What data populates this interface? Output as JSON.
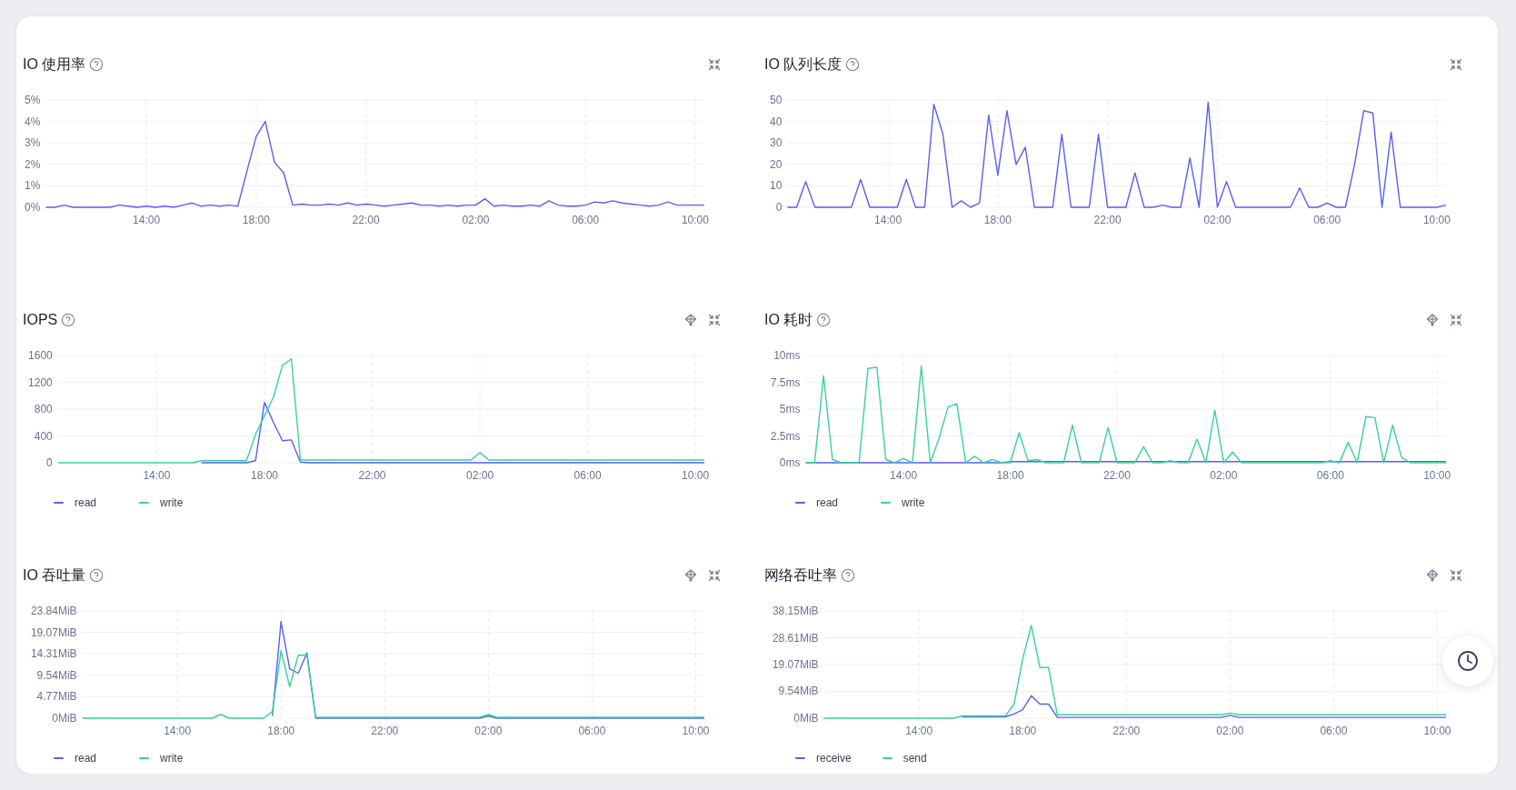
{
  "panels": [
    {
      "title": "IO 使用率",
      "chart_data": {
        "type": "line",
        "grid": true,
        "ylim": [
          0,
          5
        ],
        "categories": [
          null,
          null,
          null,
          null,
          null,
          null,
          null,
          null,
          null,
          null,
          null,
          "14:00",
          null,
          null,
          null,
          null,
          null,
          null,
          null,
          null,
          null,
          null,
          null,
          "18:00",
          null,
          null,
          null,
          null,
          null,
          null,
          null,
          null,
          null,
          null,
          null,
          "22:00",
          null,
          null,
          null,
          null,
          null,
          null,
          null,
          null,
          null,
          null,
          null,
          "02:00",
          null,
          null,
          null,
          null,
          null,
          null,
          null,
          null,
          null,
          null,
          null,
          "06:00",
          null,
          null,
          null,
          null,
          null,
          null,
          null,
          null,
          null,
          null,
          null,
          "10:00",
          null
        ],
        "yticks": [
          {
            "value": 0,
            "label": "0%"
          },
          {
            "value": 1,
            "label": "1%"
          },
          {
            "value": 2,
            "label": "2%"
          },
          {
            "value": 3,
            "label": "3%"
          },
          {
            "value": 4,
            "label": "4%"
          },
          {
            "value": 5,
            "label": "5%"
          }
        ],
        "values": [
          0,
          0,
          0.1,
          0,
          0,
          0,
          0,
          0,
          0.1,
          0.05,
          0,
          0.05,
          0,
          0.05,
          0,
          0.1,
          0.2,
          0.05,
          0.1,
          0.05,
          0.1,
          0.05,
          1.7,
          3.3,
          4.0,
          2.1,
          1.6,
          0.1,
          0.15,
          0.1,
          0.1,
          0.15,
          0.1,
          0.2,
          0.1,
          0.15,
          0.1,
          0.05,
          0.1,
          0.15,
          0.2,
          0.1,
          0.1,
          0.05,
          0.1,
          0.05,
          0.1,
          0.1,
          0.4,
          0.05,
          0.1,
          0.05,
          0.05,
          0.1,
          0.05,
          0.3,
          0.1,
          0.05,
          0.05,
          0.1,
          0.25,
          0.2,
          0.3,
          0.2,
          0.15,
          0.1,
          0.05,
          0.1,
          0.25,
          0.1,
          0.1,
          0.1,
          0.1
        ]
      }
    },
    {
      "title": "IO 队列长度",
      "chart_data": {
        "type": "line",
        "grid": true,
        "ylim": [
          0,
          50
        ],
        "categories": [
          null,
          null,
          null,
          null,
          null,
          null,
          null,
          null,
          null,
          null,
          null,
          "14:00",
          null,
          null,
          null,
          null,
          null,
          null,
          null,
          null,
          null,
          null,
          null,
          "18:00",
          null,
          null,
          null,
          null,
          null,
          null,
          null,
          null,
          null,
          null,
          null,
          "22:00",
          null,
          null,
          null,
          null,
          null,
          null,
          null,
          null,
          null,
          null,
          null,
          "02:00",
          null,
          null,
          null,
          null,
          null,
          null,
          null,
          null,
          null,
          null,
          null,
          "06:00",
          null,
          null,
          null,
          null,
          null,
          null,
          null,
          null,
          null,
          null,
          null,
          "10:00",
          null
        ],
        "yticks": [
          0,
          10,
          20,
          30,
          40,
          50
        ],
        "values": [
          0,
          0,
          12,
          0,
          0,
          0,
          0,
          0,
          13,
          0,
          0,
          0,
          0,
          13,
          0,
          0,
          48,
          34,
          0,
          3,
          0,
          2,
          43,
          15,
          45,
          20,
          28,
          0,
          0,
          0,
          34,
          0,
          0,
          0,
          34,
          0,
          0,
          0,
          16,
          0,
          0,
          1,
          0,
          0,
          23,
          0,
          49,
          0,
          12,
          0,
          0,
          0,
          0,
          0,
          0,
          0,
          9,
          0,
          0,
          2,
          0,
          0,
          20,
          45,
          44,
          0,
          35,
          0,
          0,
          0,
          0,
          0,
          1
        ]
      }
    },
    {
      "title": "IOPS",
      "chart_data": {
        "type": "line",
        "grid": true,
        "ylim": [
          0,
          1600
        ],
        "categories": [
          null,
          null,
          null,
          null,
          null,
          null,
          null,
          null,
          null,
          null,
          null,
          "14:00",
          null,
          null,
          null,
          null,
          null,
          null,
          null,
          null,
          null,
          null,
          null,
          "18:00",
          null,
          null,
          null,
          null,
          null,
          null,
          null,
          null,
          null,
          null,
          null,
          "22:00",
          null,
          null,
          null,
          null,
          null,
          null,
          null,
          null,
          null,
          null,
          null,
          "02:00",
          null,
          null,
          null,
          null,
          null,
          null,
          null,
          null,
          null,
          null,
          null,
          "06:00",
          null,
          null,
          null,
          null,
          null,
          null,
          null,
          null,
          null,
          null,
          null,
          "10:00",
          null
        ],
        "yticks": [
          0,
          400,
          800,
          1200,
          1600
        ],
        "series": [
          {
            "name": "read",
            "color": "#5b5ff5",
            "values": [
              null,
              null,
              null,
              null,
              null,
              null,
              null,
              null,
              null,
              null,
              null,
              null,
              null,
              null,
              null,
              null,
              0,
              0,
              0,
              0,
              0,
              0,
              30,
              900,
              600,
              330,
              340,
              10,
              0,
              0,
              0,
              0,
              0,
              0,
              0,
              0,
              0,
              0,
              0,
              0,
              0,
              0,
              0,
              0,
              0,
              0,
              0,
              0,
              0,
              0,
              0,
              0,
              0,
              0,
              0,
              0,
              0,
              0,
              0,
              0,
              0,
              0,
              0,
              0,
              0,
              0,
              0,
              0,
              0,
              0,
              0,
              0,
              0
            ]
          },
          {
            "name": "write",
            "color": "#36d399",
            "values": [
              0,
              0,
              0,
              0,
              0,
              0,
              0,
              0,
              0,
              0,
              0,
              0,
              0,
              0,
              0,
              0,
              30,
              30,
              30,
              30,
              30,
              30,
              420,
              700,
              980,
              1450,
              1550,
              40,
              40,
              40,
              40,
              40,
              40,
              40,
              40,
              40,
              40,
              40,
              40,
              40,
              40,
              40,
              40,
              40,
              40,
              40,
              40,
              150,
              40,
              40,
              40,
              40,
              40,
              40,
              40,
              40,
              40,
              40,
              40,
              40,
              40,
              40,
              40,
              40,
              40,
              40,
              40,
              40,
              40,
              40,
              40,
              40,
              40
            ]
          }
        ]
      }
    },
    {
      "title": "IO 耗时",
      "chart_data": {
        "type": "line",
        "grid": true,
        "ylim": [
          0,
          10
        ],
        "categories": [
          null,
          null,
          null,
          null,
          null,
          null,
          null,
          null,
          null,
          null,
          null,
          "14:00",
          null,
          null,
          null,
          null,
          null,
          null,
          null,
          null,
          null,
          null,
          null,
          "18:00",
          null,
          null,
          null,
          null,
          null,
          null,
          null,
          null,
          null,
          null,
          null,
          "22:00",
          null,
          null,
          null,
          null,
          null,
          null,
          null,
          null,
          null,
          null,
          null,
          "02:00",
          null,
          null,
          null,
          null,
          null,
          null,
          null,
          null,
          null,
          null,
          null,
          "06:00",
          null,
          null,
          null,
          null,
          null,
          null,
          null,
          null,
          null,
          null,
          null,
          "10:00",
          null
        ],
        "yticks": [
          {
            "value": 0,
            "label": "0ms"
          },
          {
            "value": 2.5,
            "label": "2.5ms"
          },
          {
            "value": 5,
            "label": "5ms"
          },
          {
            "value": 7.5,
            "label": "7.5ms"
          },
          {
            "value": 10,
            "label": "10ms"
          }
        ],
        "series": [
          {
            "name": "read",
            "color": "#5b5ff5",
            "values": [
              0,
              0,
              0,
              0,
              0,
              0,
              0,
              0,
              0,
              0,
              0,
              0,
              0,
              0,
              0,
              0,
              0,
              0,
              0,
              0,
              0,
              0,
              0,
              0.1,
              0.1,
              0.1,
              0.1,
              0.1,
              0.1,
              0.1,
              0.1,
              0.1,
              0.1,
              0.1,
              0.1,
              0.1,
              0.1,
              0.1,
              0.1,
              0.1,
              0.1,
              0.1,
              0.1,
              0.1,
              0.1,
              0.1,
              0.1,
              0.1,
              0.1,
              0.1,
              0.1,
              0.1,
              0.1,
              0.1,
              0.1,
              0.1,
              0.1,
              0.1,
              0.1,
              0.1,
              0.1,
              0.1,
              0.1,
              0.1,
              0.1,
              0.1,
              0.1,
              0.1,
              0.1,
              0.1,
              0.1,
              0.1,
              0.1
            ]
          },
          {
            "name": "write",
            "color": "#36d399",
            "values": [
              0,
              0,
              8.1,
              0.3,
              0,
              0,
              0,
              8.8,
              8.9,
              0.3,
              0,
              0.4,
              0,
              9.0,
              0,
              2.3,
              5.2,
              5.5,
              0,
              0.6,
              0,
              0.3,
              0,
              0,
              2.8,
              0.2,
              0.3,
              0,
              0,
              0,
              3.5,
              0,
              0,
              0,
              3.3,
              0,
              0,
              0,
              1.5,
              0,
              0,
              0.2,
              0,
              0,
              2.2,
              0,
              4.9,
              0,
              1.0,
              0,
              0,
              0,
              0,
              0,
              0,
              0,
              0,
              0,
              0,
              0.2,
              0,
              1.9,
              0,
              4.3,
              4.2,
              0,
              3.5,
              0.5,
              0,
              0,
              0,
              0,
              0
            ]
          }
        ]
      }
    },
    {
      "title": "IO 吞吐量",
      "chart_data": {
        "type": "line",
        "grid": true,
        "ylim": [
          0,
          23.84
        ],
        "categories": [
          null,
          null,
          null,
          null,
          null,
          null,
          null,
          null,
          null,
          null,
          null,
          "14:00",
          null,
          null,
          null,
          null,
          null,
          null,
          null,
          null,
          null,
          null,
          null,
          "18:00",
          null,
          null,
          null,
          null,
          null,
          null,
          null,
          null,
          null,
          null,
          null,
          "22:00",
          null,
          null,
          null,
          null,
          null,
          null,
          null,
          null,
          null,
          null,
          null,
          "02:00",
          null,
          null,
          null,
          null,
          null,
          null,
          null,
          null,
          null,
          null,
          null,
          "06:00",
          null,
          null,
          null,
          null,
          null,
          null,
          null,
          null,
          null,
          null,
          null,
          "10:00",
          null
        ],
        "yticks": [
          {
            "value": 0,
            "label": "0MiB"
          },
          {
            "value": 4.77,
            "label": "4.77MiB"
          },
          {
            "value": 9.54,
            "label": "9.54MiB"
          },
          {
            "value": 14.31,
            "label": "14.31MiB"
          },
          {
            "value": 19.07,
            "label": "19.07MiB"
          },
          {
            "value": 23.84,
            "label": "23.84MiB"
          }
        ],
        "series": [
          {
            "name": "read",
            "color": "#5b5ff5",
            "values": [
              null,
              null,
              null,
              null,
              null,
              null,
              null,
              null,
              null,
              null,
              null,
              null,
              null,
              null,
              null,
              null,
              null,
              null,
              null,
              null,
              null,
              null,
              0.5,
              21.5,
              11,
              10,
              14.5,
              0,
              0,
              0,
              0,
              0,
              0,
              0,
              0,
              0,
              0,
              0,
              0,
              0,
              0,
              0,
              0,
              0,
              0,
              0,
              0,
              0.5,
              0,
              0,
              0,
              0,
              0,
              0,
              0,
              0,
              0,
              0,
              0,
              0,
              0,
              0,
              0,
              0,
              0,
              0,
              0,
              0,
              0,
              0,
              0,
              0,
              0
            ]
          },
          {
            "name": "write",
            "color": "#36d399",
            "values": [
              0,
              0,
              0,
              0,
              0,
              0,
              0,
              0,
              0,
              0,
              0,
              0,
              0,
              0,
              0,
              0,
              0.8,
              0,
              0,
              0,
              0,
              0,
              1.5,
              15,
              7,
              14,
              14,
              0.2,
              0.2,
              0.2,
              0.2,
              0.2,
              0.2,
              0.2,
              0.2,
              0.2,
              0.2,
              0.2,
              0.2,
              0.2,
              0.2,
              0.2,
              0.2,
              0.2,
              0.2,
              0.2,
              0.2,
              0.8,
              0.2,
              0.2,
              0.2,
              0.2,
              0.2,
              0.2,
              0.2,
              0.2,
              0.2,
              0.2,
              0.2,
              0.2,
              0.2,
              0.2,
              0.2,
              0.2,
              0.2,
              0.2,
              0.2,
              0.2,
              0.2,
              0.2,
              0.2,
              0.2,
              0.2
            ]
          }
        ]
      }
    },
    {
      "title": "网络吞吐率",
      "chart_data": {
        "type": "line",
        "grid": true,
        "ylim": [
          0,
          38.15
        ],
        "categories": [
          null,
          null,
          null,
          null,
          null,
          null,
          null,
          null,
          null,
          null,
          null,
          "14:00",
          null,
          null,
          null,
          null,
          null,
          null,
          null,
          null,
          null,
          null,
          null,
          "18:00",
          null,
          null,
          null,
          null,
          null,
          null,
          null,
          null,
          null,
          null,
          null,
          "22:00",
          null,
          null,
          null,
          null,
          null,
          null,
          null,
          null,
          null,
          null,
          null,
          "02:00",
          null,
          null,
          null,
          null,
          null,
          null,
          null,
          null,
          null,
          null,
          null,
          "06:00",
          null,
          null,
          null,
          null,
          null,
          null,
          null,
          null,
          null,
          null,
          null,
          "10:00",
          null
        ],
        "yticks": [
          {
            "value": 0,
            "label": "0MiB"
          },
          {
            "value": 9.54,
            "label": "9.54MiB"
          },
          {
            "value": 19.07,
            "label": "19.07MiB"
          },
          {
            "value": 28.61,
            "label": "28.61MiB"
          },
          {
            "value": 38.15,
            "label": "38.15MiB"
          }
        ],
        "series": [
          {
            "name": "receive",
            "color": "#5b5ff5",
            "values": [
              null,
              null,
              null,
              null,
              null,
              null,
              null,
              null,
              null,
              null,
              null,
              null,
              null,
              null,
              null,
              null,
              0.5,
              0.5,
              0.5,
              0.5,
              0.5,
              0.5,
              1.5,
              3,
              8,
              5,
              5,
              0.3,
              0.3,
              0.3,
              0.3,
              0.3,
              0.3,
              0.3,
              0.3,
              0.3,
              0.3,
              0.3,
              0.3,
              0.3,
              0.3,
              0.3,
              0.3,
              0.3,
              0.3,
              0.3,
              0.3,
              1,
              0.3,
              0.3,
              0.3,
              0.3,
              0.3,
              0.3,
              0.3,
              0.3,
              0.3,
              0.3,
              0.3,
              0.3,
              0.3,
              0.3,
              0.3,
              0.3,
              0.3,
              0.3,
              0.3,
              0.3,
              0.3,
              0.3,
              0.3,
              0.3,
              0.3
            ]
          },
          {
            "name": "send",
            "color": "#36d399",
            "values": [
              0,
              0,
              0,
              0,
              0,
              0,
              0,
              0,
              0,
              0,
              0,
              0,
              0,
              0,
              0,
              0,
              0.8,
              0.8,
              0.8,
              0.8,
              0.8,
              0.8,
              5,
              21,
              33,
              18,
              18,
              1.2,
              1.2,
              1.2,
              1.2,
              1.2,
              1.2,
              1.2,
              1.2,
              1.2,
              1.2,
              1.2,
              1.2,
              1.2,
              1.2,
              1.2,
              1.2,
              1.2,
              1.2,
              1.2,
              1.2,
              1.8,
              1.2,
              1.2,
              1.2,
              1.2,
              1.2,
              1.2,
              1.2,
              1.2,
              1.2,
              1.2,
              1.2,
              1.2,
              1.2,
              1.2,
              1.2,
              1.2,
              1.2,
              1.2,
              1.2,
              1.2,
              1.2,
              1.2,
              1.2,
              1.2,
              1.2
            ]
          }
        ]
      }
    }
  ]
}
